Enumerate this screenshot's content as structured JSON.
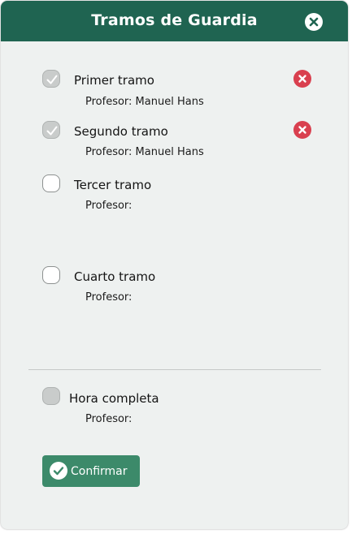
{
  "dialog": {
    "title": "Tramos de Guardia",
    "close_icon": "close-icon"
  },
  "tramos": [
    {
      "label": "Primer tramo",
      "checked": true,
      "teacher_label": "Profesor: Manuel Hans",
      "removable": true
    },
    {
      "label": "Segundo tramo",
      "checked": true,
      "teacher_label": "Profesor: Manuel Hans",
      "removable": true
    },
    {
      "label": "Tercer tramo",
      "checked": false,
      "teacher_label": "Profesor:",
      "removable": false
    },
    {
      "label": "Cuarto tramo",
      "checked": false,
      "teacher_label": "Profesor:",
      "removable": false
    }
  ],
  "full_hour": {
    "label": "Hora completa",
    "checked": false,
    "disabled": true,
    "teacher_label": "Profesor:"
  },
  "confirm": {
    "label": "Confirmar",
    "icon": "check-circle-icon"
  },
  "colors": {
    "header": "#1f6451",
    "background": "#eef1f0",
    "remove": "#d9404f",
    "confirm": "#3c8a6a"
  }
}
